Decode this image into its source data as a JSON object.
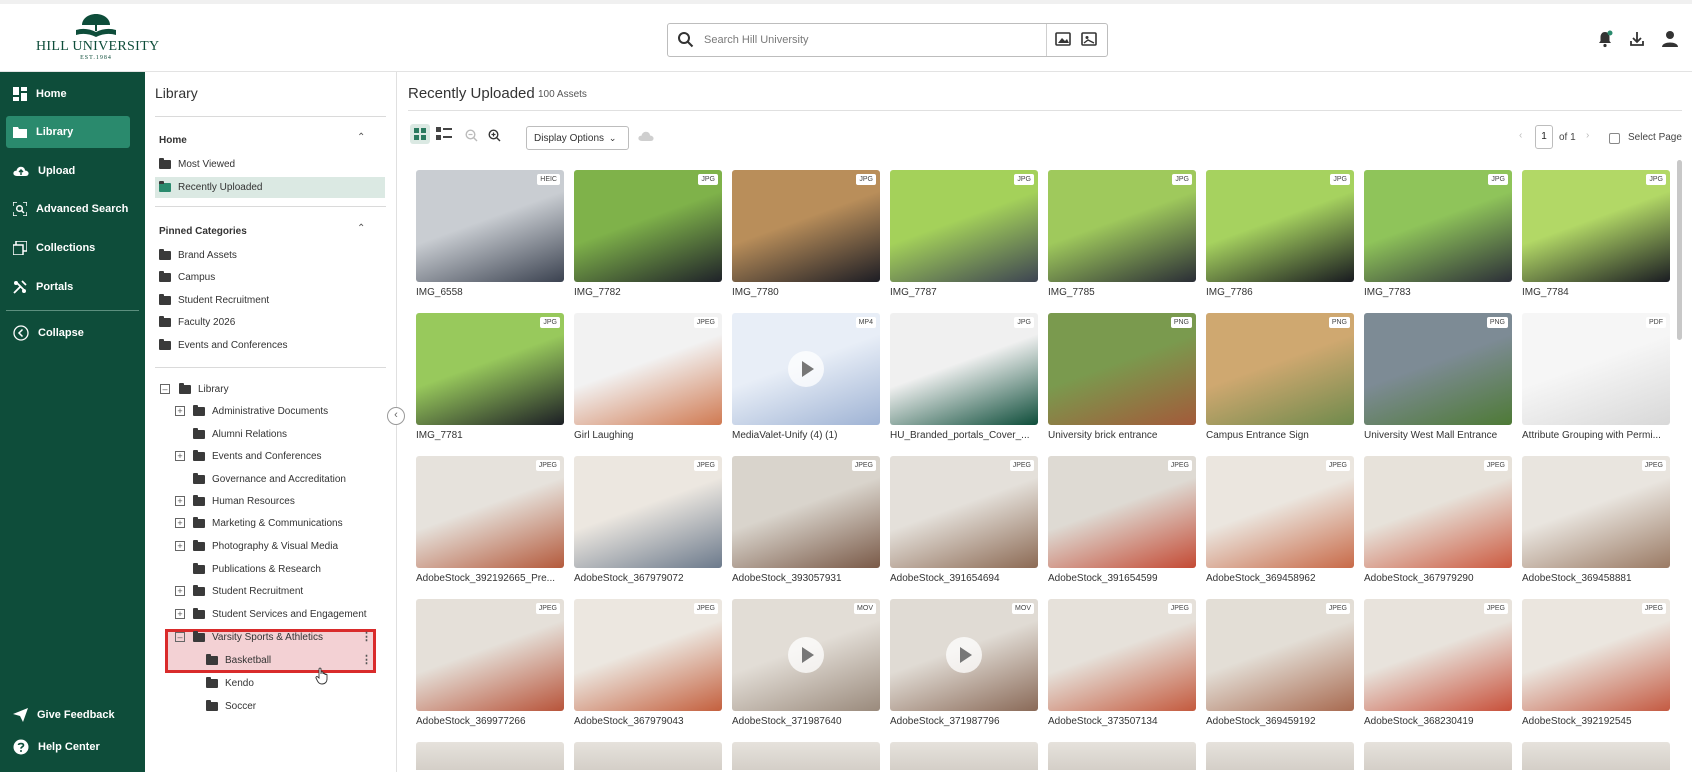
{
  "brand": {
    "name": "HILL UNIVERSITY",
    "est": "EST.1984",
    "color": "#0e4d3a"
  },
  "search": {
    "placeholder": "Search Hill University"
  },
  "nav": {
    "items": [
      {
        "label": "Home",
        "icon": "dashboard-icon"
      },
      {
        "label": "Library",
        "icon": "folder-icon",
        "active": true
      },
      {
        "label": "Upload",
        "icon": "cloud-upload-icon"
      },
      {
        "label": "Advanced Search",
        "icon": "advanced-search-icon"
      },
      {
        "label": "Collections",
        "icon": "collections-icon"
      },
      {
        "label": "Portals",
        "icon": "portals-icon"
      },
      {
        "label": "Collapse",
        "icon": "chevron-left-circle-icon"
      }
    ],
    "feedback": "Give Feedback",
    "help": "Help Center"
  },
  "library": {
    "title": "Library",
    "home_section": {
      "label": "Home",
      "items": [
        "Most Viewed",
        "Recently Uploaded"
      ]
    },
    "pinned": {
      "label": "Pinned Categories",
      "items": [
        "Brand Assets",
        "Campus",
        "Student Recruitment",
        "Faculty 2026",
        "Events and Conferences"
      ]
    },
    "tree_root": "Library",
    "tree": [
      {
        "label": "Administrative Documents",
        "expandable": true
      },
      {
        "label": "Alumni Relations",
        "expandable": false
      },
      {
        "label": "Events and Conferences",
        "expandable": true
      },
      {
        "label": "Governance and Accreditation",
        "expandable": false
      },
      {
        "label": "Human Resources",
        "expandable": true
      },
      {
        "label": "Marketing & Communications",
        "expandable": true
      },
      {
        "label": "Photography & Visual Media",
        "expandable": true
      },
      {
        "label": "Publications & Research",
        "expandable": false
      },
      {
        "label": "Student Recruitment",
        "expandable": true
      },
      {
        "label": "Student Services and Engagement",
        "expandable": true
      },
      {
        "label": "Varsity Sports & Athletics",
        "expandable": true,
        "expanded": true
      }
    ],
    "sports_children": [
      "Basketball",
      "Kendo",
      "Soccer"
    ]
  },
  "main": {
    "title": "Recently Uploaded",
    "count": "100 Assets",
    "display_options": "Display Options",
    "page": "1",
    "of": "of 1",
    "select_page": "Select Page"
  },
  "assets": [
    {
      "name": "IMG_6558",
      "type": "HEIC",
      "c1": "#c9cdd2",
      "c2": "#3b4250"
    },
    {
      "name": "IMG_7782",
      "type": "JPG",
      "c1": "#7fb24a",
      "c2": "#1f2229"
    },
    {
      "name": "IMG_7780",
      "type": "JPG",
      "c1": "#b98e5a",
      "c2": "#1d1d24"
    },
    {
      "name": "IMG_7787",
      "type": "JPG",
      "c1": "#a4d15a",
      "c2": "#3d4452"
    },
    {
      "name": "IMG_7785",
      "type": "JPG",
      "c1": "#9fc95c",
      "c2": "#2a2d36"
    },
    {
      "name": "IMG_7786",
      "type": "JPG",
      "c1": "#a6d25f",
      "c2": "#181a20"
    },
    {
      "name": "IMG_7783",
      "type": "JPG",
      "c1": "#8fc45a",
      "c2": "#2c2f38"
    },
    {
      "name": "IMG_7784",
      "type": "JPG",
      "c1": "#b2d866",
      "c2": "#1a1c22"
    },
    {
      "name": "IMG_7781",
      "type": "JPG",
      "c1": "#98c95c",
      "c2": "#1c1e25"
    },
    {
      "name": "Girl Laughing",
      "type": "JPEG",
      "c1": "#f2f2f2",
      "c2": "#d07a52"
    },
    {
      "name": "MediaValet-Unify (4) (1)",
      "type": "MP4",
      "c1": "#e8eef7",
      "c2": "#9fb3d4",
      "video": true
    },
    {
      "name": "HU_Branded_portals_Cover_...",
      "type": "JPG",
      "c1": "#f0f0f0",
      "c2": "#0e4d3a"
    },
    {
      "name": "University brick entrance",
      "type": "PNG",
      "c1": "#7a9a4e",
      "c2": "#a35a3a"
    },
    {
      "name": "Campus Entrance Sign",
      "type": "PNG",
      "c1": "#cfa870",
      "c2": "#6f8a4c"
    },
    {
      "name": "University West Mall Entrance",
      "type": "PNG",
      "c1": "#7d8b95",
      "c2": "#4e7a36"
    },
    {
      "name": "Attribute Grouping with Permi...",
      "type": "PDF",
      "c1": "#f6f6f6",
      "c2": "#d8d8d8"
    },
    {
      "name": "AdobeStock_392192665_Pre...",
      "type": "JPEG",
      "c1": "#e6e2dc",
      "c2": "#b45a3c"
    },
    {
      "name": "AdobeStock_367979072",
      "type": "JPEG",
      "c1": "#ece7e0",
      "c2": "#6c7a8c"
    },
    {
      "name": "AdobeStock_393057931",
      "type": "JPEG",
      "c1": "#d9d4cc",
      "c2": "#7a5a48"
    },
    {
      "name": "AdobeStock_391654694",
      "type": "JPEG",
      "c1": "#e4e0da",
      "c2": "#8c6a54"
    },
    {
      "name": "AdobeStock_391654599",
      "type": "JPEG",
      "c1": "#dedad3",
      "c2": "#c44a34"
    },
    {
      "name": "AdobeStock_369458962",
      "type": "JPEG",
      "c1": "#ebe6df",
      "c2": "#c86a48"
    },
    {
      "name": "AdobeStock_367979290",
      "type": "JPEG",
      "c1": "#e7e2da",
      "c2": "#cc5a40"
    },
    {
      "name": "AdobeStock_369458881",
      "type": "JPEG",
      "c1": "#e9e5df",
      "c2": "#9a7a64"
    },
    {
      "name": "AdobeStock_369977266",
      "type": "JPEG",
      "c1": "#e5e0d9",
      "c2": "#b8543a"
    },
    {
      "name": "AdobeStock_367979043",
      "type": "JPEG",
      "c1": "#ece7e0",
      "c2": "#c4603e"
    },
    {
      "name": "AdobeStock_371987640",
      "type": "MOV",
      "c1": "#e2ddd6",
      "c2": "#9a8a7c",
      "video": true
    },
    {
      "name": "AdobeStock_371987796",
      "type": "MOV",
      "c1": "#e0dbd4",
      "c2": "#8a6a58",
      "video": true
    },
    {
      "name": "AdobeStock_373507134",
      "type": "JPEG",
      "c1": "#e6e1da",
      "c2": "#c45a3e"
    },
    {
      "name": "AdobeStock_369459192",
      "type": "JPEG",
      "c1": "#e3ded6",
      "c2": "#a86a50"
    },
    {
      "name": "AdobeStock_368230419",
      "type": "JPEG",
      "c1": "#e8e3dc",
      "c2": "#c8503a"
    },
    {
      "name": "AdobeStock_392192545",
      "type": "JPEG",
      "c1": "#ebe6df",
      "c2": "#c45a42"
    }
  ]
}
